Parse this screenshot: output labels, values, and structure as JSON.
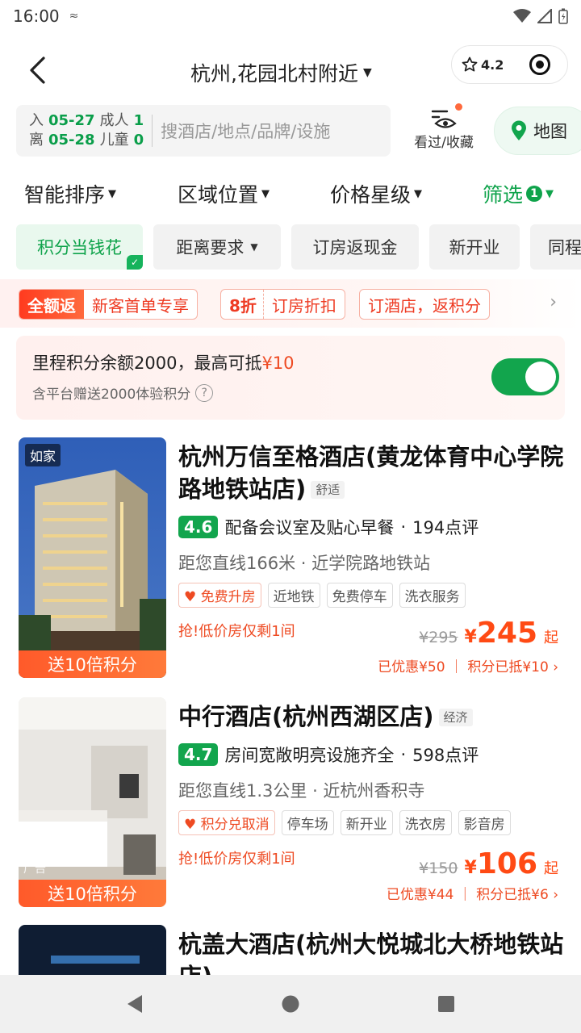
{
  "status": {
    "time": "16:00"
  },
  "header": {
    "title": "杭州,花园北村附近",
    "favorite_score": "4.2"
  },
  "search": {
    "checkin_label": "入",
    "checkin_date": "05-27",
    "checkout_label": "离",
    "checkout_date": "05-28",
    "adults_label": "成人",
    "adults_count": "1",
    "children_label": "儿童",
    "children_count": "0",
    "placeholder": "搜酒店/地点/品牌/设施",
    "history_label": "看过/收藏",
    "map_label": "地图"
  },
  "sort": {
    "items": [
      "智能排序",
      "区域位置",
      "价格星级",
      "筛选"
    ],
    "filter_count": "1"
  },
  "chips": [
    "积分当钱花",
    "距离要求",
    "订房返现金",
    "新开业",
    "同程"
  ],
  "promo": {
    "tag1_fill": "全额返",
    "tag1_text": "新客首单专享",
    "tag2_bold": "8折",
    "tag2_text": "订房折扣",
    "tag3_text": "订酒店，返积分"
  },
  "points": {
    "line1": "里程积分余额2000，最高可抵",
    "amount": "¥10",
    "line2": "含平台赠送2000体验积分",
    "toggle_on": true
  },
  "hotels": [
    {
      "name": "杭州万信至格酒店(黄龙体育中心学院路地铁站店)",
      "level": "舒适",
      "image_tag": "如家",
      "image_ad": "",
      "bonus": "送10倍积分",
      "score": "4.6",
      "highlight": "配备会议室及贴心早餐",
      "reviews": "194点评",
      "distance": "距您直线166米 · 近学院路地铁站",
      "tags": [
        "免费升房",
        "近地铁",
        "免费停车",
        "洗衣服务"
      ],
      "hurry": "抢!低价房仅剩1间",
      "orig_price": "¥295",
      "yen": "¥",
      "price": "245",
      "qi": "起",
      "discount": "已优惠¥50 ｜ 积分已抵¥10 ›"
    },
    {
      "name": "中行酒店(杭州西湖区店)",
      "level": "经济",
      "image_tag": "",
      "image_ad": "广告",
      "bonus": "送10倍积分",
      "score": "4.7",
      "highlight": "房间宽敞明亮设施齐全",
      "reviews": "598点评",
      "distance": "距您直线1.3公里 · 近杭州香积寺",
      "tags": [
        "积分兑取消",
        "停车场",
        "新开业",
        "洗衣房",
        "影音房"
      ],
      "hurry": "抢!低价房仅剩1间",
      "orig_price": "¥150",
      "yen": "¥",
      "price": "106",
      "qi": "起",
      "discount": "已优惠¥44 ｜ 积分已抵¥6 ›"
    },
    {
      "name": "杭盖大酒店(杭州大悦城北大桥地铁站店)"
    }
  ]
}
